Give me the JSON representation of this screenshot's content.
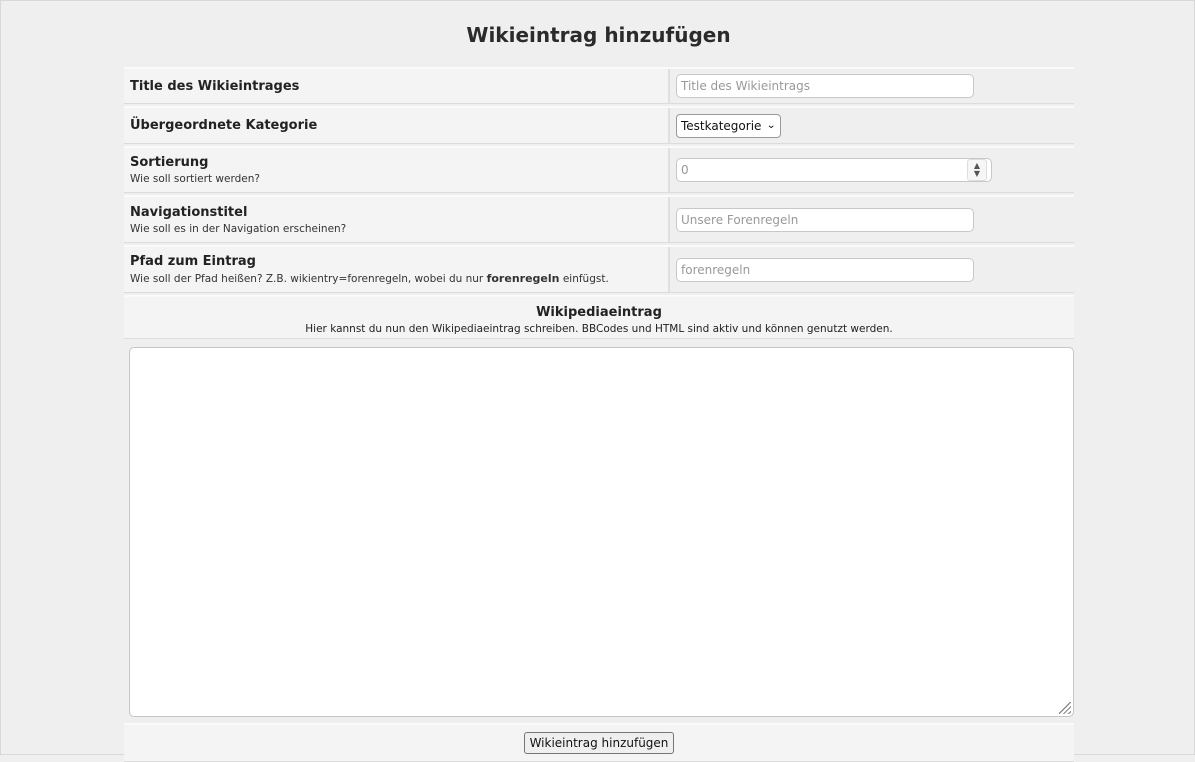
{
  "page": {
    "title": "Wikieintrag hinzufügen"
  },
  "fields": {
    "title": {
      "label": "Title des Wikieintrages",
      "placeholder": "Title des Wikieintrags"
    },
    "category": {
      "label": "Übergeordnete Kategorie",
      "selected": "Testkategorie"
    },
    "sort": {
      "label": "Sortierung",
      "hint": "Wie soll sortiert werden?",
      "value": "0"
    },
    "nav_title": {
      "label": "Navigationstitel",
      "hint": "Wie soll es in der Navigation erscheinen?",
      "placeholder": "Unsere Forenregeln"
    },
    "path": {
      "label": "Pfad zum Eintrag",
      "hint_before": "Wie soll der Pfad heißen? Z.B. wikientry=forenregeln, wobei du nur",
      "hint_bold": "forenregeln",
      "hint_after": "einfügst.",
      "placeholder": "forenregeln"
    }
  },
  "editor": {
    "title": "Wikipediaeintrag",
    "hint": "Hier kannst du nun den Wikipediaeintrag schreiben. BBCodes und HTML sind aktiv und können genutzt werden."
  },
  "submit": {
    "label": "Wikieintrag hinzufügen"
  }
}
